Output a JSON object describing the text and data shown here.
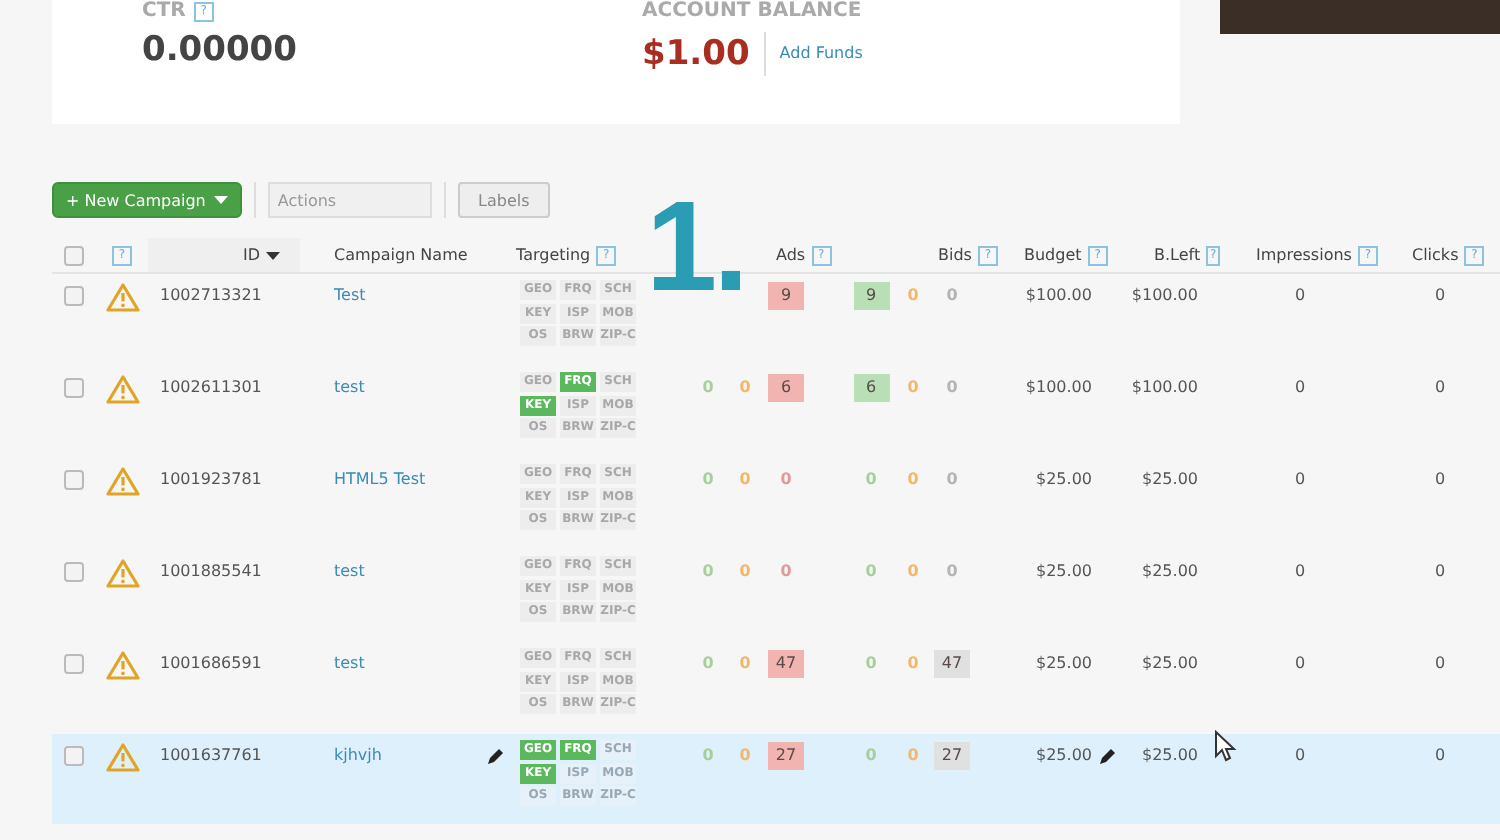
{
  "stats": {
    "ctr": {
      "label": "CTR",
      "help": "?",
      "value": "0.00000"
    },
    "balance": {
      "label": "ACCOUNT BALANCE",
      "value": "$1.00",
      "link": "Add Funds"
    }
  },
  "toolbar": {
    "new_button": "+ New Campaign",
    "actions": {
      "placeholder": "Actions"
    },
    "labels_button": "Labels"
  },
  "annotation": "1.",
  "table": {
    "select_all": {
      "checked": false
    },
    "columns": [
      {},
      {
        "help": "?"
      },
      {
        "label": "ID",
        "sorted": true
      },
      {
        "label": "Campaign Name"
      },
      {
        "label": "Targeting",
        "help": "?"
      },
      {},
      {},
      {
        "label": "Ads",
        "help": "?"
      },
      {},
      {},
      {
        "label": "Bids",
        "help": "?"
      },
      {
        "label": "Budget",
        "help": "?"
      },
      {
        "label": "B.Left",
        "help": "?"
      },
      {
        "label": "Impressions",
        "help": "?"
      },
      {
        "label": "Clicks",
        "help": "?"
      }
    ],
    "rows": [
      {
        "checked": false,
        "selected": false,
        "id": "1002713321",
        "name": "Test",
        "tags": [
          {
            "label": "GEO",
            "on": false
          },
          {
            "label": "FRQ",
            "on": false
          },
          {
            "label": "SCH",
            "on": false
          },
          {
            "label": "KEY",
            "on": false
          },
          {
            "label": "ISP",
            "on": false
          },
          {
            "label": "MOB",
            "on": false
          },
          {
            "label": "OS",
            "on": false
          },
          {
            "label": "BRW",
            "on": false
          },
          {
            "label": "ZIP-C",
            "on": false
          }
        ],
        "counts": [
          {
            "text": "9",
            "color": "#f2b4b0",
            "badge": true
          },
          {
            "text": "9",
            "color": "#b8dfb5",
            "badge": true
          },
          {
            "text": "0",
            "color": "#f0b86a",
            "badge": false
          },
          {
            "text": "0",
            "color": "#b4b4b4",
            "badge": false
          }
        ],
        "budget": "$100.00",
        "bleft": "$100.00",
        "impressions": "0",
        "clicks": "0"
      },
      {
        "checked": false,
        "selected": false,
        "id": "1002611301",
        "name": "test",
        "tags": [
          {
            "label": "GEO",
            "on": false
          },
          {
            "label": "FRQ",
            "on": true
          },
          {
            "label": "SCH",
            "on": false
          },
          {
            "label": "KEY",
            "on": true
          },
          {
            "label": "ISP",
            "on": false
          },
          {
            "label": "MOB",
            "on": false
          },
          {
            "label": "OS",
            "on": false
          },
          {
            "label": "BRW",
            "on": false
          },
          {
            "label": "ZIP-C",
            "on": false
          }
        ],
        "counts": [
          {
            "text": "0",
            "color": "#a6cf9e",
            "badge": false
          },
          {
            "text": "0",
            "color": "#f0b86a",
            "badge": false
          },
          {
            "text": "6",
            "color": "#f2b4b0",
            "badge": true
          },
          {
            "text": "6",
            "color": "#b8dfb5",
            "badge": true
          },
          {
            "text": "0",
            "color": "#f0b86a",
            "badge": false
          },
          {
            "text": "0",
            "color": "#b4b4b4",
            "badge": false
          }
        ],
        "budget": "$100.00",
        "bleft": "$100.00",
        "impressions": "0",
        "clicks": "0"
      },
      {
        "checked": false,
        "selected": false,
        "id": "1001923781",
        "name": "HTML5 Test",
        "tags": [
          {
            "label": "GEO",
            "on": false
          },
          {
            "label": "FRQ",
            "on": false
          },
          {
            "label": "SCH",
            "on": false
          },
          {
            "label": "KEY",
            "on": false
          },
          {
            "label": "ISP",
            "on": false
          },
          {
            "label": "MOB",
            "on": false
          },
          {
            "label": "OS",
            "on": false
          },
          {
            "label": "BRW",
            "on": false
          },
          {
            "label": "ZIP-C",
            "on": false
          }
        ],
        "counts": [
          {
            "text": "0",
            "color": "#a6cf9e",
            "badge": false
          },
          {
            "text": "0",
            "color": "#f0b86a",
            "badge": false
          },
          {
            "text": "0",
            "color": "#e09a9a",
            "badge": false
          },
          {
            "text": "0",
            "color": "#a6cf9e",
            "badge": false
          },
          {
            "text": "0",
            "color": "#f0b86a",
            "badge": false
          },
          {
            "text": "0",
            "color": "#b4b4b4",
            "badge": false
          }
        ],
        "budget": "$25.00",
        "bleft": "$25.00",
        "impressions": "0",
        "clicks": "0"
      },
      {
        "checked": false,
        "selected": false,
        "id": "1001885541",
        "name": "test",
        "tags": [
          {
            "label": "GEO",
            "on": false
          },
          {
            "label": "FRQ",
            "on": false
          },
          {
            "label": "SCH",
            "on": false
          },
          {
            "label": "KEY",
            "on": false
          },
          {
            "label": "ISP",
            "on": false
          },
          {
            "label": "MOB",
            "on": false
          },
          {
            "label": "OS",
            "on": false
          },
          {
            "label": "BRW",
            "on": false
          },
          {
            "label": "ZIP-C",
            "on": false
          }
        ],
        "counts": [
          {
            "text": "0",
            "color": "#a6cf9e",
            "badge": false
          },
          {
            "text": "0",
            "color": "#f0b86a",
            "badge": false
          },
          {
            "text": "0",
            "color": "#e09a9a",
            "badge": false
          },
          {
            "text": "0",
            "color": "#a6cf9e",
            "badge": false
          },
          {
            "text": "0",
            "color": "#f0b86a",
            "badge": false
          },
          {
            "text": "0",
            "color": "#b4b4b4",
            "badge": false
          }
        ],
        "budget": "$25.00",
        "bleft": "$25.00",
        "impressions": "0",
        "clicks": "0"
      },
      {
        "checked": false,
        "selected": false,
        "id": "1001686591",
        "name": "test",
        "tags": [
          {
            "label": "GEO",
            "on": false
          },
          {
            "label": "FRQ",
            "on": false
          },
          {
            "label": "SCH",
            "on": false
          },
          {
            "label": "KEY",
            "on": false
          },
          {
            "label": "ISP",
            "on": false
          },
          {
            "label": "MOB",
            "on": false
          },
          {
            "label": "OS",
            "on": false
          },
          {
            "label": "BRW",
            "on": false
          },
          {
            "label": "ZIP-C",
            "on": false
          }
        ],
        "counts": [
          {
            "text": "0",
            "color": "#a6cf9e",
            "badge": false
          },
          {
            "text": "0",
            "color": "#f0b86a",
            "badge": false
          },
          {
            "text": "47",
            "color": "#f2b4b0",
            "badge": true
          },
          {
            "text": "0",
            "color": "#a6cf9e",
            "badge": false
          },
          {
            "text": "0",
            "color": "#f0b86a",
            "badge": false
          },
          {
            "text": "47",
            "color": "#e0e0e0",
            "badge": true
          }
        ],
        "budget": "$25.00",
        "bleft": "$25.00",
        "impressions": "0",
        "clicks": "0"
      },
      {
        "checked": false,
        "selected": true,
        "id": "1001637761",
        "name": "kjhvjh",
        "tags": [
          {
            "label": "GEO",
            "on": true
          },
          {
            "label": "FRQ",
            "on": true
          },
          {
            "label": "SCH",
            "on": false
          },
          {
            "label": "KEY",
            "on": true
          },
          {
            "label": "ISP",
            "on": false
          },
          {
            "label": "MOB",
            "on": false
          },
          {
            "label": "OS",
            "on": false
          },
          {
            "label": "BRW",
            "on": false
          },
          {
            "label": "ZIP-C",
            "on": false
          }
        ],
        "counts": [
          {
            "text": "0",
            "color": "#a6cf9e",
            "badge": false
          },
          {
            "text": "0",
            "color": "#f0b86a",
            "badge": false
          },
          {
            "text": "27",
            "color": "#f2b4b0",
            "badge": true
          },
          {
            "text": "0",
            "color": "#a6cf9e",
            "badge": false
          },
          {
            "text": "0",
            "color": "#f0b86a",
            "badge": false
          },
          {
            "text": "27",
            "color": "#e0e0e0",
            "badge": true
          }
        ],
        "budget": "$25.00",
        "bleft": "$25.00",
        "impressions": "0",
        "clicks": "0"
      }
    ]
  }
}
